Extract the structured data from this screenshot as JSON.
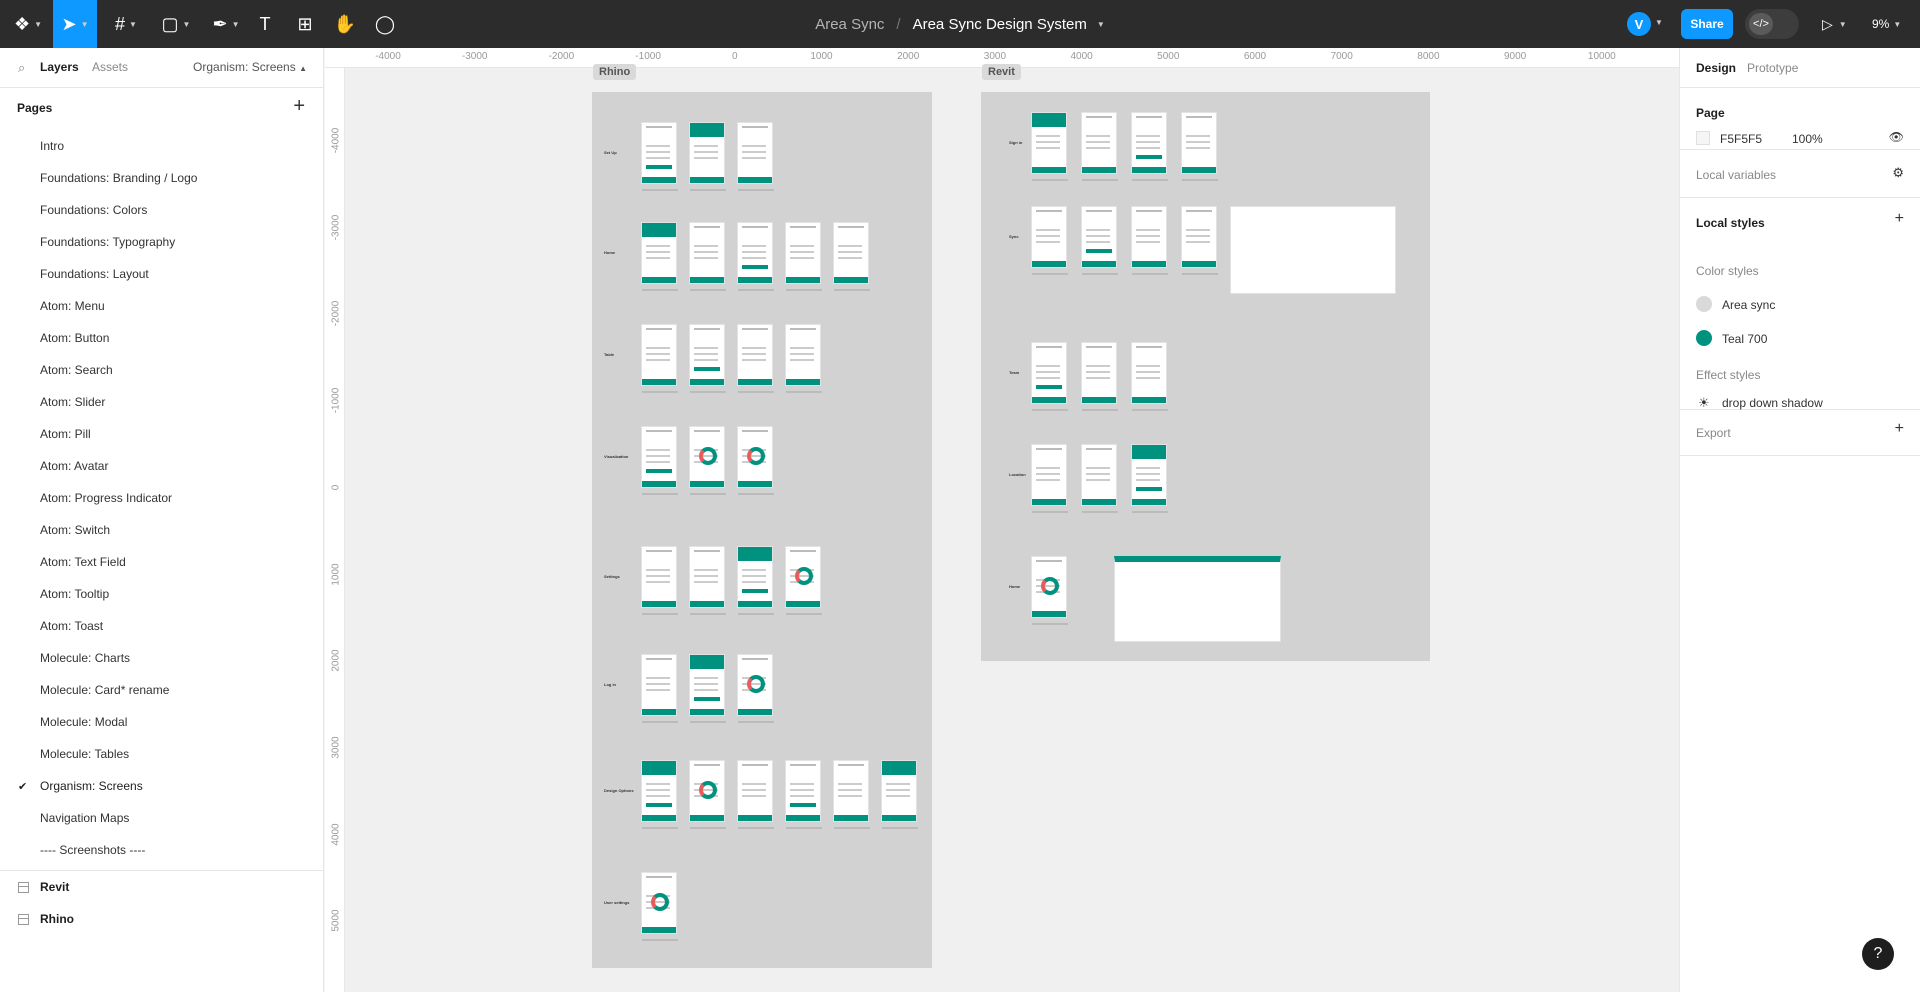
{
  "toolbar": {
    "main_menu_icon": "figma-logo-icon",
    "tools": [
      {
        "name": "move-tool",
        "glyph": "➤"
      },
      {
        "name": "frame-tool",
        "glyph": "#"
      },
      {
        "name": "shape-tool",
        "glyph": "▢"
      },
      {
        "name": "pen-tool",
        "glyph": "✒"
      },
      {
        "name": "text-tool",
        "glyph": "T"
      },
      {
        "name": "resources-tool",
        "glyph": "⊞"
      },
      {
        "name": "hand-tool",
        "glyph": "✋"
      },
      {
        "name": "comment-tool",
        "glyph": "◯"
      }
    ],
    "project": "Area Sync",
    "separator": "/",
    "file": "Area Sync Design System",
    "avatar_initial": "V",
    "share": "Share",
    "devmode_glyph": "</>",
    "play_glyph": "▷",
    "zoom": "9%"
  },
  "left_panel": {
    "tab_layers": "Layers",
    "tab_assets": "Assets",
    "current_page": "Organism: Screens",
    "pages_label": "Pages",
    "add_glyph": "+",
    "pages": [
      "Intro",
      "Foundations: Branding / Logo",
      "Foundations: Colors",
      "Foundations: Typography",
      "Foundations: Layout",
      "Atom: Menu",
      "Atom: Button",
      "Atom: Search",
      "Atom: Slider",
      "Atom: Pill",
      "Atom: Avatar",
      "Atom: Progress Indicator",
      "Atom: Switch",
      "Atom: Text Field",
      "Atom: Tooltip",
      "Atom: Toast",
      "Molecule: Charts",
      "Molecule: Card* rename",
      "Molecule: Modal",
      "Molecule: Tables",
      "Organism: Screens",
      "Navigation Maps",
      "---- Screenshots ----"
    ],
    "layers": [
      "Revit",
      "Rhino"
    ]
  },
  "canvas": {
    "ruler_x": [
      "-4000",
      "-3000",
      "-2000",
      "-1000",
      "0",
      "1000",
      "2000",
      "3000",
      "4000",
      "5000",
      "6000",
      "7000",
      "8000",
      "9000",
      "10000"
    ],
    "ruler_y": [
      "-4000",
      "-3000",
      "-2000",
      "-1000",
      "0",
      "1000",
      "2000",
      "3000",
      "4000",
      "5000"
    ],
    "sections": {
      "rhino": {
        "label": "Rhino",
        "rows": [
          {
            "label": "Set Up",
            "count": 3
          },
          {
            "label": "Home",
            "count": 5
          },
          {
            "label": "Table",
            "count": 4
          },
          {
            "label": "Visualization",
            "count": 3
          },
          {
            "label": "Settings",
            "count": 4
          },
          {
            "label": "Log in",
            "count": 3
          },
          {
            "label": "Design Options",
            "count": 6
          },
          {
            "label": "User settings",
            "count": 1
          }
        ]
      },
      "revit": {
        "label": "Revit",
        "rows": [
          {
            "label": "Sign in",
            "count": 4
          },
          {
            "label": "Sync",
            "count": 4
          },
          {
            "label": "Team",
            "count": 3
          },
          {
            "label": "Location",
            "count": 3
          },
          {
            "label": "Home",
            "count": 1
          }
        ]
      }
    }
  },
  "right_panel": {
    "tab_design": "Design",
    "tab_prototype": "Prototype",
    "page_label": "Page",
    "page_color": "F5F5F5",
    "page_opacity": "100%",
    "eye_glyph": "👁",
    "local_variables": "Local variables",
    "variables_glyph": "⚙",
    "local_styles": "Local styles",
    "add_glyph": "+",
    "color_styles_label": "Color styles",
    "color_styles": [
      {
        "name": "Area sync",
        "color": "#d9d9d9"
      },
      {
        "name": "Teal 700",
        "color": "#00927f"
      }
    ],
    "effect_styles_label": "Effect styles",
    "effect_styles": [
      {
        "name": "drop down shadow",
        "glyph": "☀"
      }
    ],
    "export_label": "Export"
  },
  "help_glyph": "?"
}
